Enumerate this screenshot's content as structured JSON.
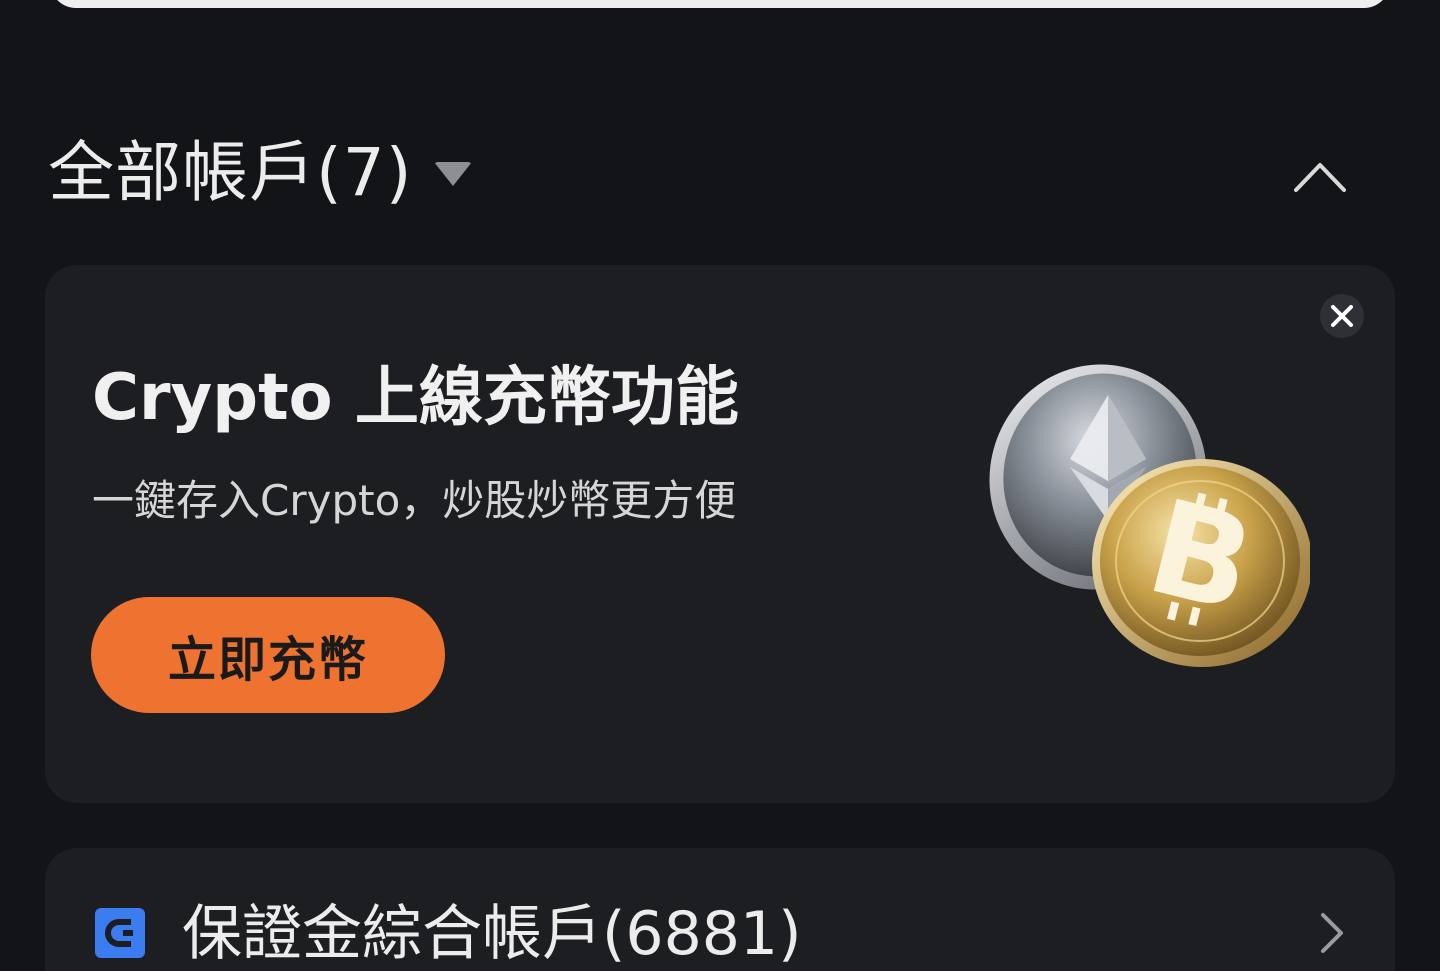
{
  "header": {
    "title": "全部帳戶(7)"
  },
  "promo": {
    "title": "Crypto 上線充幣功能",
    "subtitle": "一鍵存入Crypto，炒股炒幣更方便",
    "cta_label": "立即充幣",
    "cta_color": "#ee7330"
  },
  "account": {
    "label": "保證金綜合帳戶(6881)",
    "icon_color": "#3b7cf0"
  },
  "icons": {
    "caret": "caret-down-icon",
    "collapse": "chevron-up-icon",
    "close": "close-icon",
    "coins": "crypto-coins-illustration",
    "account": "wallet-icon",
    "row_chevron": "chevron-right-icon"
  }
}
